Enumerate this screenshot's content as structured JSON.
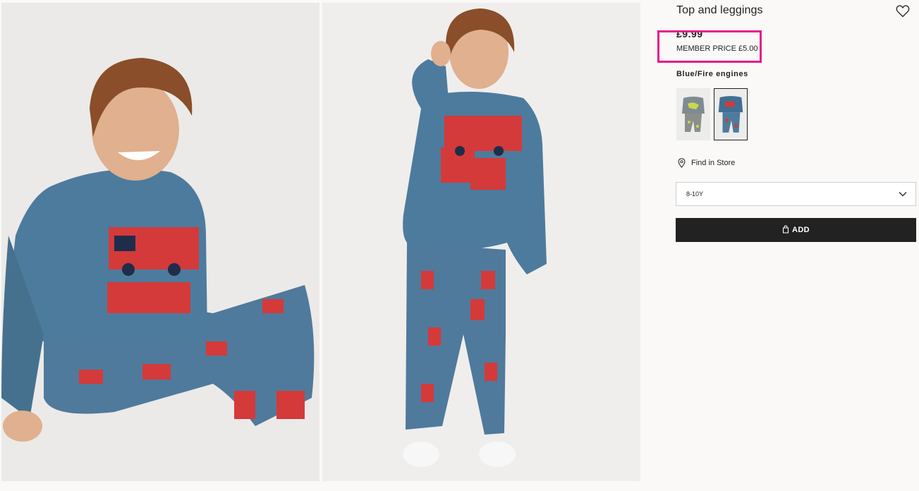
{
  "product": {
    "title": "Top and leggings",
    "price": "£9.99",
    "member_price": "MEMBER PRICE £5.00",
    "color_name": "Blue/Fire engines"
  },
  "images": [
    {
      "icon": "product-photo-sitting"
    },
    {
      "icon": "product-photo-standing"
    }
  ],
  "swatches": [
    {
      "icon": "swatch-grey-dinosaur",
      "selected": false
    },
    {
      "icon": "swatch-blue-fire-engines",
      "selected": true
    }
  ],
  "store": {
    "find_label": "Find in Store",
    "icon": "location-pin-icon"
  },
  "size_select": {
    "value": "8-10Y",
    "icon": "chevron-down-icon"
  },
  "add_button": {
    "label": "ADD",
    "icon": "shopping-bag-icon"
  },
  "favorite": {
    "icon": "heart-icon"
  },
  "colors": {
    "accent_highlight": "#e6198c",
    "button_bg": "#222222",
    "garment_blue": "#4f7a9c",
    "background": "#faf9f8"
  }
}
